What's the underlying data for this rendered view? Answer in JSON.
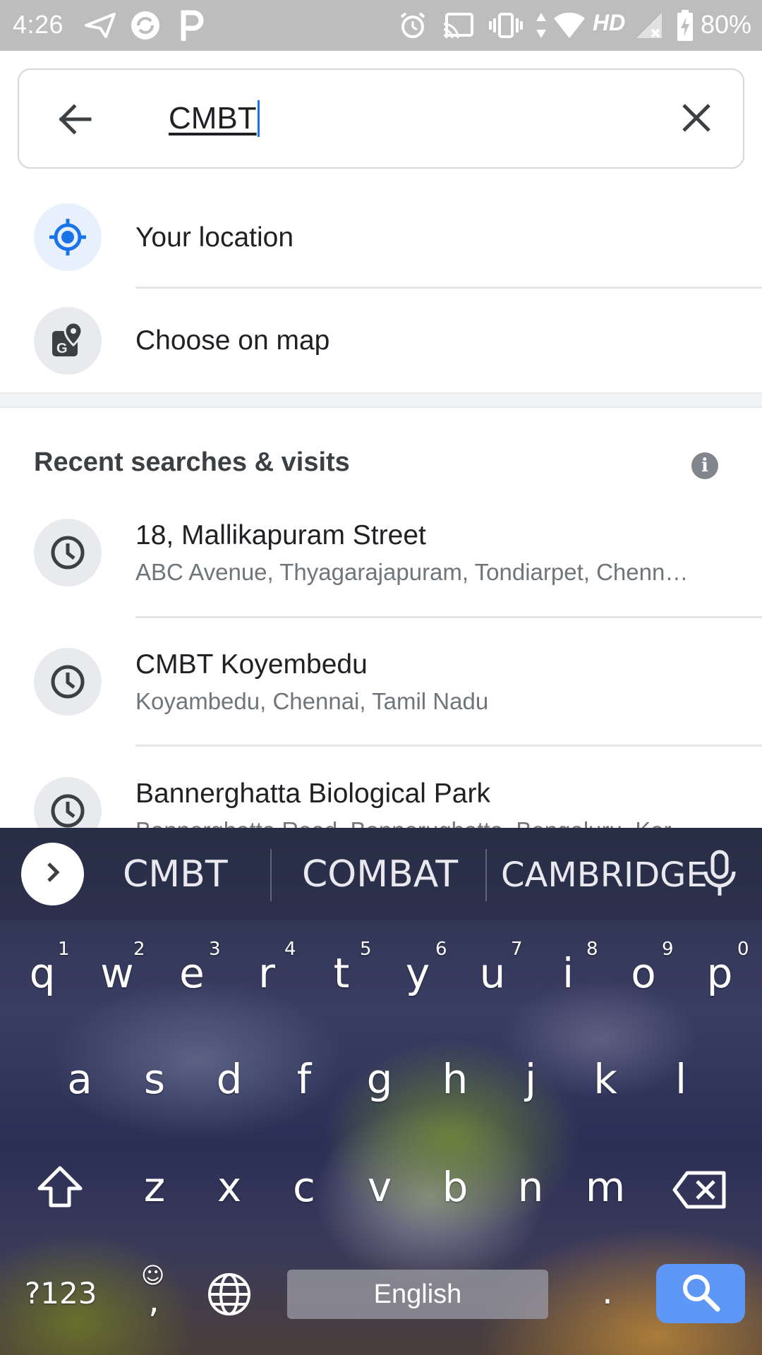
{
  "status_bar": {
    "time": "4:26",
    "network_label": "HD",
    "battery": "80%"
  },
  "search": {
    "query": "CMBT",
    "back_icon": "arrow-back-icon",
    "clear_icon": "close-icon"
  },
  "quick_options": [
    {
      "label": "Your location",
      "icon": "my-location-icon"
    },
    {
      "label": "Choose on map",
      "icon": "map-pin-icon"
    }
  ],
  "recent": {
    "header": "Recent searches & visits",
    "info_glyph": "i",
    "items": [
      {
        "title": "18, Mallikapuram Street",
        "subtitle": "ABC Avenue, Thyagarajapuram, Tondiarpet, Chenn…"
      },
      {
        "title": "CMBT Koyembedu",
        "subtitle": "Koyambedu, Chennai, Tamil Nadu"
      },
      {
        "title": "Bannerghatta Biological Park",
        "subtitle": "Bannerghatta Road, Bannerughatta, Bengaluru, Kar…"
      }
    ]
  },
  "keyboard": {
    "suggestions": [
      "CMBT",
      "COMBAT",
      "CAMBRIDGE"
    ],
    "row1": [
      "q",
      "w",
      "e",
      "r",
      "t",
      "y",
      "u",
      "i",
      "o",
      "p"
    ],
    "row1_hints": [
      "1",
      "2",
      "3",
      "4",
      "5",
      "6",
      "7",
      "8",
      "9",
      "0"
    ],
    "row2": [
      "a",
      "s",
      "d",
      "f",
      "g",
      "h",
      "j",
      "k",
      "l"
    ],
    "row3": [
      "z",
      "x",
      "c",
      "v",
      "b",
      "n",
      "m"
    ],
    "symbols_key": "?123",
    "comma_key": ",",
    "emoji_hint": "☺",
    "period_key": ".",
    "space_label": "English"
  },
  "colors": {
    "accent": "#1a73e8",
    "search_key": "#5e97f6",
    "status_bar": "#bdbdbd"
  }
}
